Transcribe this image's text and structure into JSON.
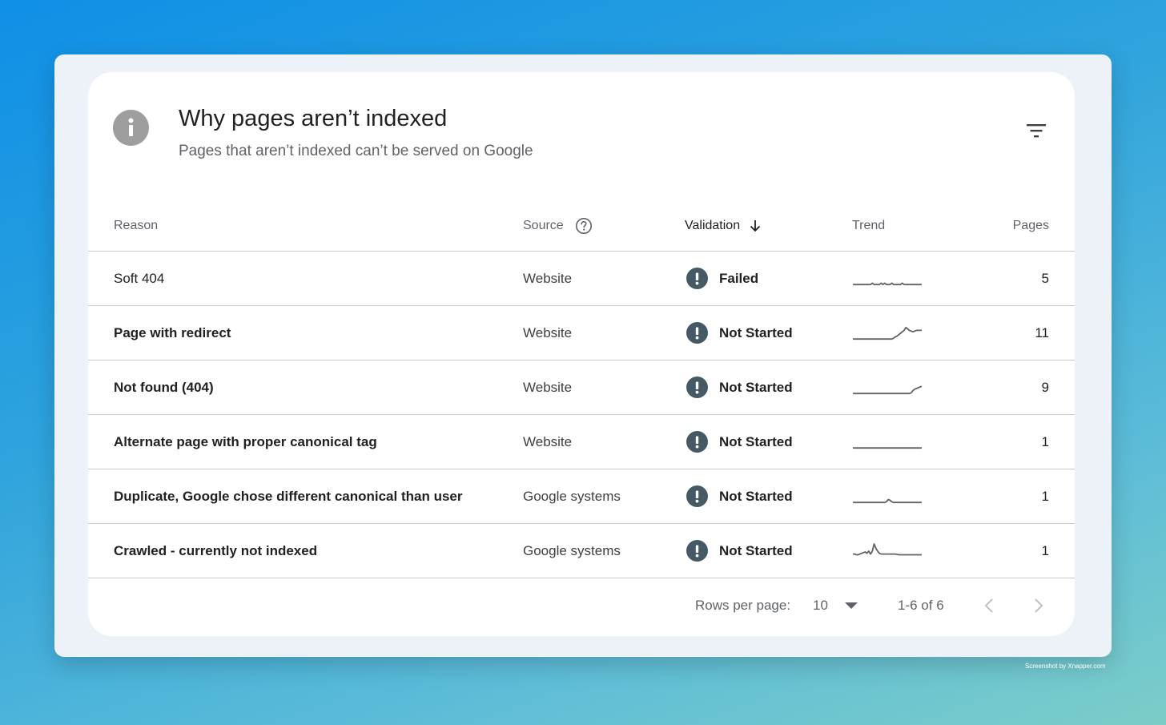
{
  "header": {
    "title": "Why pages aren’t indexed",
    "subtitle": "Pages that aren’t indexed can’t be served on Google",
    "icon": "info-icon",
    "filter_icon": "filter-icon"
  },
  "table": {
    "columns": {
      "reason": "Reason",
      "source": "Source",
      "validation": "Validation",
      "trend": "Trend",
      "pages": "Pages"
    },
    "sort_column": "Validation",
    "sort_direction": "descending",
    "rows": [
      {
        "reason": "Soft 404",
        "source": "Website",
        "validation": "Failed",
        "pages": "5",
        "trend": [
          0.1,
          0.1,
          0.1,
          0.1,
          0.1,
          0.1,
          0.1,
          0.1,
          0.1,
          0.1,
          0.1,
          0.2,
          0.1,
          0.1,
          0.1,
          0.1,
          0.2,
          0.1,
          0.2,
          0.1,
          0.1,
          0.1,
          0.2,
          0.1,
          0.1,
          0.1,
          0.1,
          0.1,
          0.2,
          0.1,
          0.1,
          0.1,
          0.1,
          0.1,
          0.1,
          0.1,
          0.1,
          0.1,
          0.1,
          0.1
        ]
      },
      {
        "reason": "Page with redirect",
        "source": "Website",
        "validation": "Not Started",
        "pages": "11",
        "trend": [
          0.1,
          0.1,
          0.1,
          0.1,
          0.1,
          0.1,
          0.1,
          0.1,
          0.1,
          0.1,
          0.1,
          0.1,
          0.1,
          0.1,
          0.1,
          0.1,
          0.1,
          0.1,
          0.1,
          0.1,
          0.1,
          0.1,
          0.1,
          0.15,
          0.25,
          0.3,
          0.4,
          0.5,
          0.6,
          0.7,
          0.9,
          0.8,
          0.7,
          0.65,
          0.6,
          0.65,
          0.7,
          0.7,
          0.7,
          0.7
        ]
      },
      {
        "reason": "Not found (404)",
        "source": "Website",
        "validation": "Not Started",
        "pages": "9",
        "trend": [
          0.1,
          0.1,
          0.1,
          0.1,
          0.1,
          0.1,
          0.1,
          0.1,
          0.1,
          0.1,
          0.1,
          0.1,
          0.1,
          0.1,
          0.1,
          0.1,
          0.1,
          0.1,
          0.1,
          0.1,
          0.1,
          0.1,
          0.1,
          0.1,
          0.1,
          0.1,
          0.1,
          0.1,
          0.1,
          0.1,
          0.1,
          0.1,
          0.1,
          0.15,
          0.3,
          0.4,
          0.45,
          0.5,
          0.55,
          0.6
        ]
      },
      {
        "reason": "Alternate page with proper canonical tag",
        "source": "Website",
        "validation": "Not Started",
        "pages": "1",
        "trend": [
          0.1,
          0.1,
          0.1,
          0.1,
          0.1,
          0.1,
          0.1,
          0.1,
          0.1,
          0.1,
          0.1,
          0.1,
          0.1,
          0.1,
          0.1,
          0.1,
          0.1,
          0.1,
          0.1,
          0.1,
          0.1,
          0.1,
          0.1,
          0.1,
          0.1,
          0.1,
          0.1,
          0.1,
          0.1,
          0.1,
          0.1,
          0.1,
          0.1,
          0.1,
          0.1,
          0.1,
          0.1,
          0.1,
          0.1,
          0.1
        ]
      },
      {
        "reason": "Duplicate, Google chose different canonical than user",
        "source": "Google systems",
        "validation": "Not Started",
        "pages": "1",
        "trend": [
          0.1,
          0.1,
          0.1,
          0.1,
          0.1,
          0.1,
          0.1,
          0.1,
          0.1,
          0.1,
          0.1,
          0.1,
          0.1,
          0.1,
          0.1,
          0.1,
          0.1,
          0.1,
          0.1,
          0.15,
          0.3,
          0.25,
          0.15,
          0.1,
          0.1,
          0.1,
          0.1,
          0.1,
          0.1,
          0.1,
          0.1,
          0.1,
          0.1,
          0.1,
          0.1,
          0.1,
          0.1,
          0.1,
          0.1,
          0.1
        ]
      },
      {
        "reason": "Crawled - currently not indexed",
        "source": "Google systems",
        "validation": "Not Started",
        "pages": "1",
        "trend": [
          0.3,
          0.3,
          0.25,
          0.25,
          0.3,
          0.35,
          0.4,
          0.45,
          0.35,
          0.5,
          0.3,
          0.5,
          1.0,
          0.7,
          0.5,
          0.35,
          0.3,
          0.3,
          0.3,
          0.3,
          0.3,
          0.3,
          0.3,
          0.3,
          0.3,
          0.28,
          0.25,
          0.25,
          0.25,
          0.25,
          0.25,
          0.25,
          0.25,
          0.25,
          0.25,
          0.25,
          0.25,
          0.25,
          0.25,
          0.25
        ]
      }
    ]
  },
  "pagination": {
    "rows_per_page_label": "Rows per page:",
    "rows_per_page_value": "10",
    "range_text": "1-6 of 6"
  },
  "watermark": "Screenshot by Xnapper.com",
  "colors": {
    "badge": "#455a64",
    "trend_line": "#5f6368",
    "header_icon": "#9e9e9e"
  }
}
